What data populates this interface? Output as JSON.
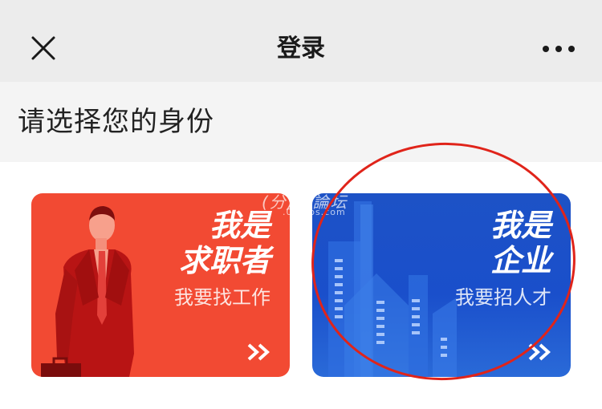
{
  "header": {
    "title": "登录",
    "close_icon": "close-icon",
    "more_icon": "more-horizontal-icon"
  },
  "section": {
    "title": "请选择您的身份"
  },
  "cards": {
    "seeker": {
      "title_line1": "我是",
      "title_line2": "求职者",
      "subtitle": "我要找工作",
      "color": "#f24a33",
      "icon": "double-chevron-right-icon"
    },
    "company": {
      "title_line1": "我是",
      "title_line2": "企业",
      "subtitle": "我要招人才",
      "color": "#1d52c6",
      "icon": "double-chevron-right-icon"
    }
  },
  "watermark": {
    "logo_text": "(分)分論坛",
    "url_text": ".05 bbs.com"
  },
  "colors": {
    "highlight_circle": "#e0241a"
  }
}
